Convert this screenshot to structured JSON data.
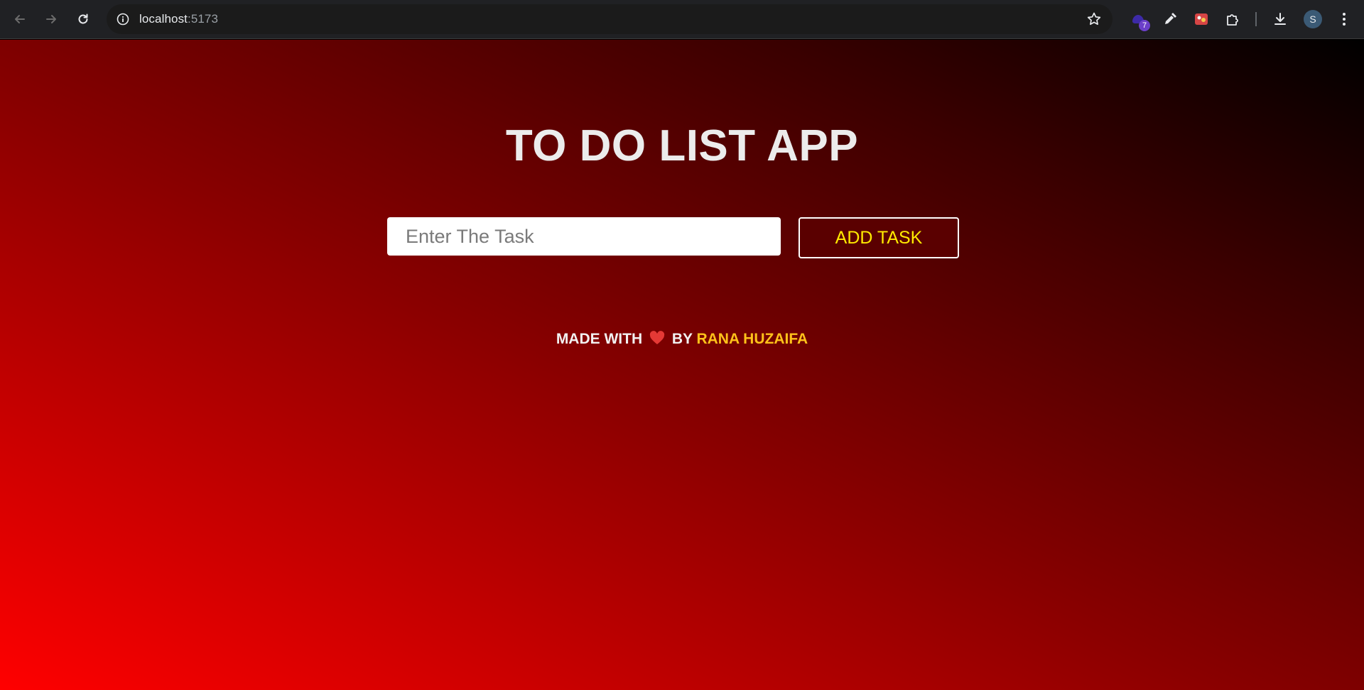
{
  "browser": {
    "url_host": "localhost",
    "url_port": ":5173",
    "extension_badge": "7",
    "profile_initial": "S"
  },
  "app": {
    "title": "TO DO LIST APP",
    "input_placeholder": "Enter The Task",
    "input_value": "",
    "add_button_label": "ADD TASK",
    "credit_prefix": "MADE WITH",
    "credit_by": "BY",
    "credit_author": "RANA HUZAIFA"
  },
  "colors": {
    "button_text": "#ffea00",
    "author_text": "#ffc21a",
    "heart": "#e53935"
  },
  "icons": {
    "back": "arrow-left-icon",
    "forward": "arrow-right-icon",
    "reload": "reload-icon",
    "site_info": "info-icon",
    "bookmark": "star-icon",
    "heart": "heart-icon",
    "downloads": "download-icon",
    "menu": "kebab-menu-icon"
  }
}
